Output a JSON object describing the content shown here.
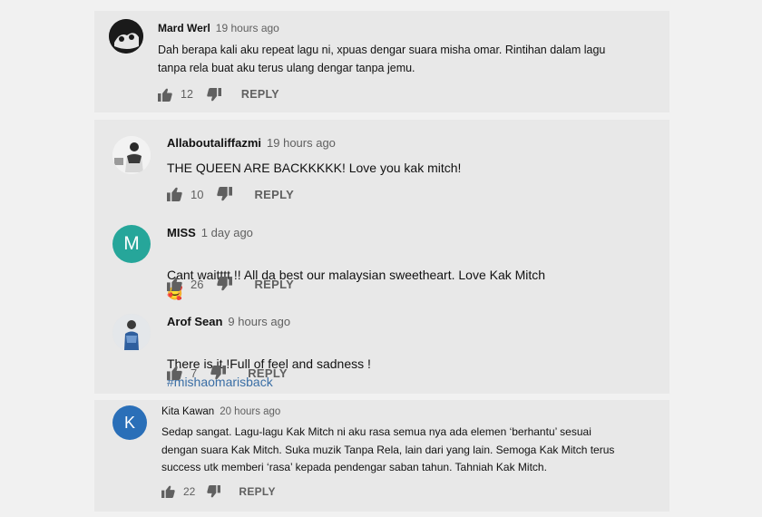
{
  "comments": [
    {
      "author": "Mard Werl",
      "time": "19 hours ago",
      "text": "Dah berapa kali aku repeat lagu ni, xpuas dengar suara misha omar. Rintihan dalam lagu\ntanpa rela buat aku terus ulang dengar tanpa jemu.",
      "likes": "12",
      "reply_label": "REPLY"
    },
    {
      "author": "Allaboutaliffazmi",
      "time": "19 hours ago",
      "text": "THE QUEEN ARE BACKKKKK! Love you kak mitch!",
      "likes": "10",
      "reply_label": "REPLY"
    },
    {
      "author": "MISS",
      "avatar_letter": "M",
      "avatar_color": "#26a69a",
      "time": "1 day ago",
      "text": "Cant waitttt !! All da best our malaysian sweetheart. Love Kak Mitch",
      "emoji": "🥰",
      "likes": "26",
      "reply_label": "REPLY"
    },
    {
      "author": "Arof Sean",
      "time": "9 hours ago",
      "text": "There is it !Full of feel and sadness !",
      "hashtag": "#mishaomarisback",
      "likes": "7",
      "reply_label": "REPLY"
    },
    {
      "author": "Kita Kawan",
      "avatar_letter": "K",
      "avatar_color": "#2a6fb8",
      "time": "20 hours ago",
      "text": "Sedap sangat. Lagu-lagu Kak Mitch ni aku rasa semua nya ada elemen ‘berhantu’ sesuai\ndengan suara Kak Mitch. Suka muzik Tanpa Rela, lain dari yang lain. Semoga Kak Mitch terus\nsuccess utk memberi ‘rasa’ kepada pendengar saban tahun. Tahniah Kak Mitch.",
      "likes": "22",
      "reply_label": "REPLY"
    }
  ]
}
